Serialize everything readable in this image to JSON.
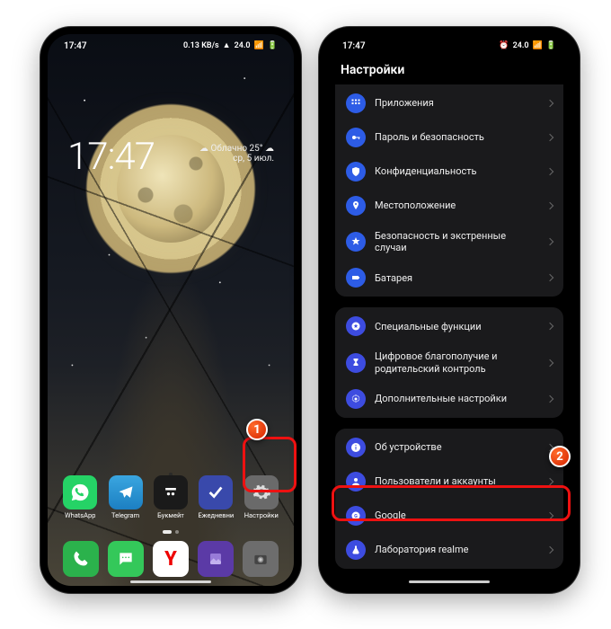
{
  "statusbar": {
    "time": "17:47",
    "net_kb": "0.13 KB/s",
    "extra": "24.0",
    "battery_icon": "battery",
    "signal": "▮▮▯"
  },
  "home": {
    "clock": "17:47",
    "weather_text": "Облачно 25°",
    "weather_icon": "☁",
    "date": "ср, 5 июл.",
    "apps_row": [
      {
        "id": "whatsapp",
        "label": "WhatsApp",
        "bg": "#25D366",
        "glyph": "wa"
      },
      {
        "id": "telegram",
        "label": "Telegram",
        "bg": "#2898e0",
        "glyph": "tg"
      },
      {
        "id": "bukmeit",
        "label": "Букмейт",
        "bg": "#1a1a1a",
        "glyph": "bm"
      },
      {
        "id": "daily",
        "label": "Ежедневни",
        "bg": "#3949ab",
        "glyph": "chk"
      },
      {
        "id": "settings",
        "label": "Настройки",
        "bg": "#5d5d5d",
        "glyph": "gear"
      }
    ],
    "dock": [
      {
        "id": "phone",
        "bg": "#2bb24c",
        "glyph": "phone"
      },
      {
        "id": "sms",
        "bg": "#34c85a",
        "glyph": "sms"
      },
      {
        "id": "yandex",
        "bg": "#ffffff",
        "glyph": "Y"
      },
      {
        "id": "gallery",
        "bg": "#5b3aa6",
        "glyph": "gal"
      },
      {
        "id": "camera",
        "bg": "#6d6d6d",
        "glyph": "cam"
      }
    ]
  },
  "settings": {
    "title": "Настройки",
    "groups": [
      [
        {
          "id": "apps",
          "icon_bg": "#2d5ce6",
          "label": "Приложения",
          "glyph": "grid"
        },
        {
          "id": "passsec",
          "icon_bg": "#2d5ce6",
          "label": "Пароль и безопасность",
          "glyph": "key"
        },
        {
          "id": "privacy",
          "icon_bg": "#2d5ce6",
          "label": "Конфиденциальность",
          "glyph": "shield"
        },
        {
          "id": "location",
          "icon_bg": "#2d5ce6",
          "label": "Местоположение",
          "glyph": "pin"
        },
        {
          "id": "emerg",
          "icon_bg": "#2d5ce6",
          "label": "Безопасность и экстренные случаи",
          "glyph": "star"
        },
        {
          "id": "battery",
          "icon_bg": "#2d5ce6",
          "label": "Батарея",
          "glyph": "bat"
        }
      ],
      [
        {
          "id": "special",
          "icon_bg": "#3d4ce0",
          "label": "Специальные функции",
          "glyph": "starcircle"
        },
        {
          "id": "digi",
          "icon_bg": "#3d4ce0",
          "label": "Цифровое благополучие и родительский контроль",
          "glyph": "hour"
        },
        {
          "id": "addl",
          "icon_bg": "#3d4ce0",
          "label": "Дополнительные настройки",
          "glyph": "cog"
        }
      ],
      [
        {
          "id": "about",
          "icon_bg": "#3d4ce0",
          "label": "Об устройстве",
          "glyph": "info"
        },
        {
          "id": "users",
          "icon_bg": "#3d4ce0",
          "label": "Пользователи и аккаунты",
          "glyph": "user"
        },
        {
          "id": "google",
          "icon_bg": "#3d4ce0",
          "label": "Google",
          "glyph": "g"
        },
        {
          "id": "lab",
          "icon_bg": "#3d4ce0",
          "label": "Лаборатория realme",
          "glyph": "flask"
        }
      ]
    ]
  },
  "callouts": {
    "one": "1",
    "two": "2"
  }
}
